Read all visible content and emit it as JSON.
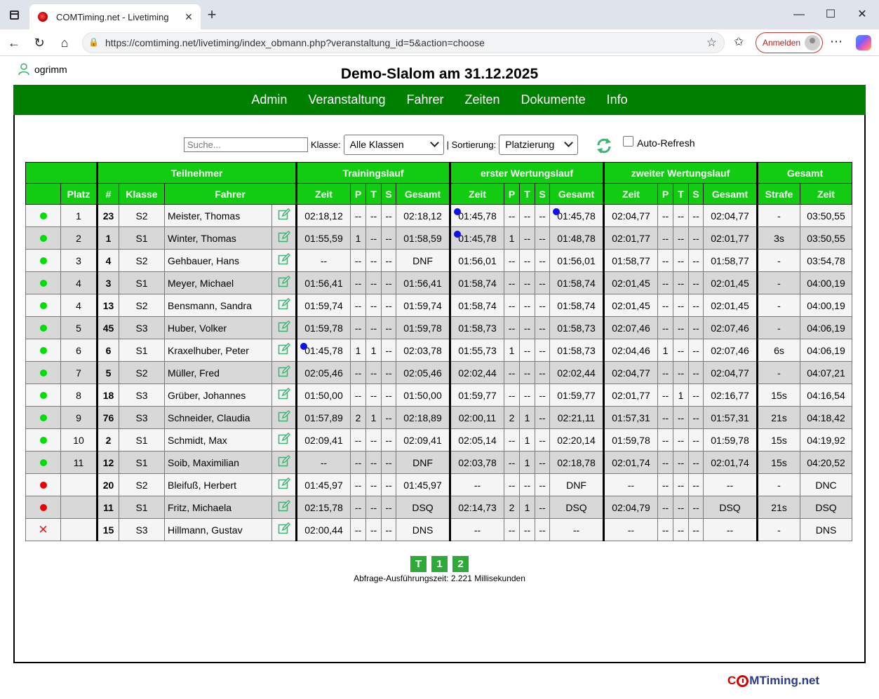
{
  "browser": {
    "tab_title": "COMTiming.net - Livetiming",
    "url": "https://comtiming.net/livetiming/index_obmann.php?veranstaltung_id=5&action=choose",
    "signin_label": "Anmelden"
  },
  "user": {
    "name": "ogrimm"
  },
  "page_title": "Demo-Slalom am 31.12.2025",
  "nav": {
    "items": [
      "Admin",
      "Veranstaltung",
      "Fahrer",
      "Zeiten",
      "Dokumente",
      "Info"
    ]
  },
  "filters": {
    "search_placeholder": "Suche...",
    "klasse_label": "Klasse:",
    "klasse_value": "Alle Klassen",
    "sort_label": "| Sortierung:",
    "sort_value": "Platzierung",
    "autorefresh_label": "Auto-Refresh"
  },
  "table": {
    "groups": [
      "Teilnehmer",
      "Trainingslauf",
      "erster Wertungslauf",
      "zweiter Wertungslauf",
      "Gesamt"
    ],
    "columns": {
      "platz": "Platz",
      "nr": "#",
      "klasse": "Klasse",
      "fahrer": "Fahrer",
      "zeit": "Zeit",
      "p": "P",
      "t": "T",
      "s": "S",
      "gesamt": "Gesamt",
      "strafe": "Strafe"
    },
    "rows": [
      {
        "status": "green",
        "platz": "1",
        "nr": "23",
        "klasse": "S2",
        "fahrer": "Meister, Thomas",
        "tr": [
          "02:18,12",
          "--",
          "--",
          "--",
          "02:18,12"
        ],
        "w1": [
          "01:45,78",
          "--",
          "--",
          "--",
          "01:45,78"
        ],
        "w2": [
          "02:04,77",
          "--",
          "--",
          "--",
          "02:04,77"
        ],
        "strafe": "-",
        "zeit": "03:50,55",
        "mark": [
          "w1z",
          "w1g"
        ]
      },
      {
        "status": "green",
        "platz": "2",
        "nr": "1",
        "klasse": "S1",
        "fahrer": "Winter, Thomas",
        "tr": [
          "01:55,59",
          "1",
          "--",
          "--",
          "01:58,59"
        ],
        "w1": [
          "01:45,78",
          "1",
          "--",
          "--",
          "01:48,78"
        ],
        "w2": [
          "02:01,77",
          "--",
          "--",
          "--",
          "02:01,77"
        ],
        "strafe": "3s",
        "zeit": "03:50,55",
        "mark": [
          "w1z"
        ]
      },
      {
        "status": "green",
        "platz": "3",
        "nr": "4",
        "klasse": "S2",
        "fahrer": "Gehbauer, Hans",
        "tr": [
          "--",
          "--",
          "--",
          "--",
          "DNF"
        ],
        "w1": [
          "01:56,01",
          "--",
          "--",
          "--",
          "01:56,01"
        ],
        "w2": [
          "01:58,77",
          "--",
          "--",
          "--",
          "01:58,77"
        ],
        "strafe": "-",
        "zeit": "03:54,78",
        "mark": []
      },
      {
        "status": "green",
        "platz": "4",
        "nr": "3",
        "klasse": "S1",
        "fahrer": "Meyer, Michael",
        "tr": [
          "01:56,41",
          "--",
          "--",
          "--",
          "01:56,41"
        ],
        "w1": [
          "01:58,74",
          "--",
          "--",
          "--",
          "01:58,74"
        ],
        "w2": [
          "02:01,45",
          "--",
          "--",
          "--",
          "02:01,45"
        ],
        "strafe": "-",
        "zeit": "04:00,19",
        "mark": []
      },
      {
        "status": "green",
        "platz": "4",
        "nr": "13",
        "klasse": "S2",
        "fahrer": "Bensmann, Sandra",
        "tr": [
          "01:59,74",
          "--",
          "--",
          "--",
          "01:59,74"
        ],
        "w1": [
          "01:58,74",
          "--",
          "--",
          "--",
          "01:58,74"
        ],
        "w2": [
          "02:01,45",
          "--",
          "--",
          "--",
          "02:01,45"
        ],
        "strafe": "-",
        "zeit": "04:00,19",
        "mark": []
      },
      {
        "status": "green",
        "platz": "5",
        "nr": "45",
        "klasse": "S3",
        "fahrer": "Huber, Volker",
        "tr": [
          "01:59,78",
          "--",
          "--",
          "--",
          "01:59,78"
        ],
        "w1": [
          "01:58,73",
          "--",
          "--",
          "--",
          "01:58,73"
        ],
        "w2": [
          "02:07,46",
          "--",
          "--",
          "--",
          "02:07,46"
        ],
        "strafe": "-",
        "zeit": "04:06,19",
        "mark": []
      },
      {
        "status": "green",
        "platz": "6",
        "nr": "6",
        "klasse": "S1",
        "fahrer": "Kraxelhuber, Peter",
        "tr": [
          "01:45,78",
          "1",
          "1",
          "--",
          "02:03,78"
        ],
        "w1": [
          "01:55,73",
          "1",
          "--",
          "--",
          "01:58,73"
        ],
        "w2": [
          "02:04,46",
          "1",
          "--",
          "--",
          "02:07,46"
        ],
        "strafe": "6s",
        "zeit": "04:06,19",
        "mark": [
          "trz"
        ]
      },
      {
        "status": "green",
        "platz": "7",
        "nr": "5",
        "klasse": "S2",
        "fahrer": "Müller, Fred",
        "tr": [
          "02:05,46",
          "--",
          "--",
          "--",
          "02:05,46"
        ],
        "w1": [
          "02:02,44",
          "--",
          "--",
          "--",
          "02:02,44"
        ],
        "w2": [
          "02:04,77",
          "--",
          "--",
          "--",
          "02:04,77"
        ],
        "strafe": "-",
        "zeit": "04:07,21",
        "mark": []
      },
      {
        "status": "green",
        "platz": "8",
        "nr": "18",
        "klasse": "S3",
        "fahrer": "Grüber, Johannes",
        "tr": [
          "01:50,00",
          "--",
          "--",
          "--",
          "01:50,00"
        ],
        "w1": [
          "01:59,77",
          "--",
          "--",
          "--",
          "01:59,77"
        ],
        "w2": [
          "02:01,77",
          "--",
          "1",
          "--",
          "02:16,77"
        ],
        "strafe": "15s",
        "zeit": "04:16,54",
        "mark": []
      },
      {
        "status": "green",
        "platz": "9",
        "nr": "76",
        "klasse": "S3",
        "fahrer": "Schneider, Claudia",
        "tr": [
          "01:57,89",
          "2",
          "1",
          "--",
          "02:18,89"
        ],
        "w1": [
          "02:00,11",
          "2",
          "1",
          "--",
          "02:21,11"
        ],
        "w2": [
          "01:57,31",
          "--",
          "--",
          "--",
          "01:57,31"
        ],
        "strafe": "21s",
        "zeit": "04:18,42",
        "mark": []
      },
      {
        "status": "green",
        "platz": "10",
        "nr": "2",
        "klasse": "S1",
        "fahrer": "Schmidt, Max",
        "tr": [
          "02:09,41",
          "--",
          "--",
          "--",
          "02:09,41"
        ],
        "w1": [
          "02:05,14",
          "--",
          "1",
          "--",
          "02:20,14"
        ],
        "w2": [
          "01:59,78",
          "--",
          "--",
          "--",
          "01:59,78"
        ],
        "strafe": "15s",
        "zeit": "04:19,92",
        "mark": []
      },
      {
        "status": "green",
        "platz": "11",
        "nr": "12",
        "klasse": "S1",
        "fahrer": "Soib, Maximilian",
        "tr": [
          "--",
          "--",
          "--",
          "--",
          "DNF"
        ],
        "w1": [
          "02:03,78",
          "--",
          "1",
          "--",
          "02:18,78"
        ],
        "w2": [
          "02:01,74",
          "--",
          "--",
          "--",
          "02:01,74"
        ],
        "strafe": "15s",
        "zeit": "04:20,52",
        "mark": []
      },
      {
        "status": "red",
        "platz": "",
        "nr": "20",
        "klasse": "S2",
        "fahrer": "Bleifuß, Herbert",
        "tr": [
          "01:45,97",
          "--",
          "--",
          "--",
          "01:45,97"
        ],
        "w1": [
          "--",
          "--",
          "--",
          "--",
          "DNF"
        ],
        "w2": [
          "--",
          "--",
          "--",
          "--",
          "--"
        ],
        "strafe": "-",
        "zeit": "DNC",
        "mark": []
      },
      {
        "status": "red",
        "platz": "",
        "nr": "11",
        "klasse": "S1",
        "fahrer": "Fritz, Michaela",
        "tr": [
          "02:15,78",
          "--",
          "--",
          "--",
          "DSQ"
        ],
        "w1": [
          "02:14,73",
          "2",
          "1",
          "--",
          "DSQ"
        ],
        "w2": [
          "02:04,79",
          "--",
          "--",
          "--",
          "DSQ"
        ],
        "strafe": "21s",
        "zeit": "DSQ",
        "mark": []
      },
      {
        "status": "x",
        "platz": "",
        "nr": "15",
        "klasse": "S3",
        "fahrer": "Hillmann, Gustav",
        "tr": [
          "02:00,44",
          "--",
          "--",
          "--",
          "DNS"
        ],
        "w1": [
          "--",
          "--",
          "--",
          "--",
          "--"
        ],
        "w2": [
          "--",
          "--",
          "--",
          "--",
          "--"
        ],
        "strafe": "-",
        "zeit": "DNS",
        "mark": []
      }
    ]
  },
  "pager": [
    "T",
    "1",
    "2"
  ],
  "exec_time": "Abfrage-Ausführungszeit: 2.221 Millisekunden",
  "brand": {
    "c": "C",
    "rest": "MTiming.net"
  }
}
